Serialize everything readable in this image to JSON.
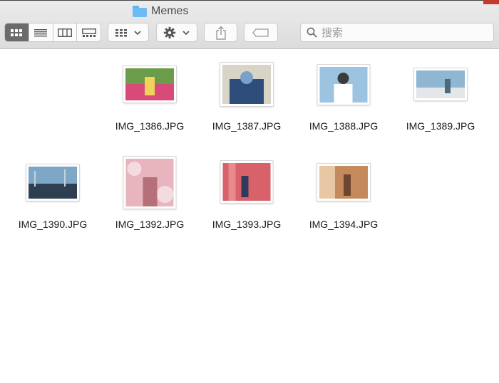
{
  "window": {
    "title": "Memes"
  },
  "toolbar": {
    "view_modes": [
      "icon-view",
      "list-view",
      "column-view",
      "gallery-view"
    ],
    "group_button": "group-by",
    "action_button": "action",
    "share_button": "share",
    "tags_button": "tags"
  },
  "search": {
    "placeholder": "搜索",
    "value": ""
  },
  "files": [
    {
      "name": "IMG_1386.JPG",
      "colors": [
        "#6a9c4a",
        "#d84a7a",
        "#f2d35a"
      ]
    },
    {
      "name": "IMG_1387.JPG",
      "colors": [
        "#2f4d7a",
        "#7aa1c9",
        "#d9d4c8"
      ]
    },
    {
      "name": "IMG_1388.JPG",
      "colors": [
        "#9cc3e0",
        "#ffffff",
        "#3b3b3b"
      ]
    },
    {
      "name": "IMG_1389.JPG",
      "colors": [
        "#8fb7d1",
        "#4a6a7e",
        "#e3e7ea"
      ]
    },
    {
      "name": "IMG_1390.JPG",
      "colors": [
        "#7ea6c6",
        "#2f3f52",
        "#c2d3df"
      ]
    },
    {
      "name": "IMG_1392.JPG",
      "colors": [
        "#e8b4bd",
        "#f3dbe0",
        "#b6707a"
      ]
    },
    {
      "name": "IMG_1393.JPG",
      "colors": [
        "#d9616a",
        "#e98a8f",
        "#2e3b5a"
      ]
    },
    {
      "name": "IMG_1394.JPG",
      "colors": [
        "#c58a5c",
        "#e7c7a4",
        "#6b4630"
      ]
    }
  ]
}
